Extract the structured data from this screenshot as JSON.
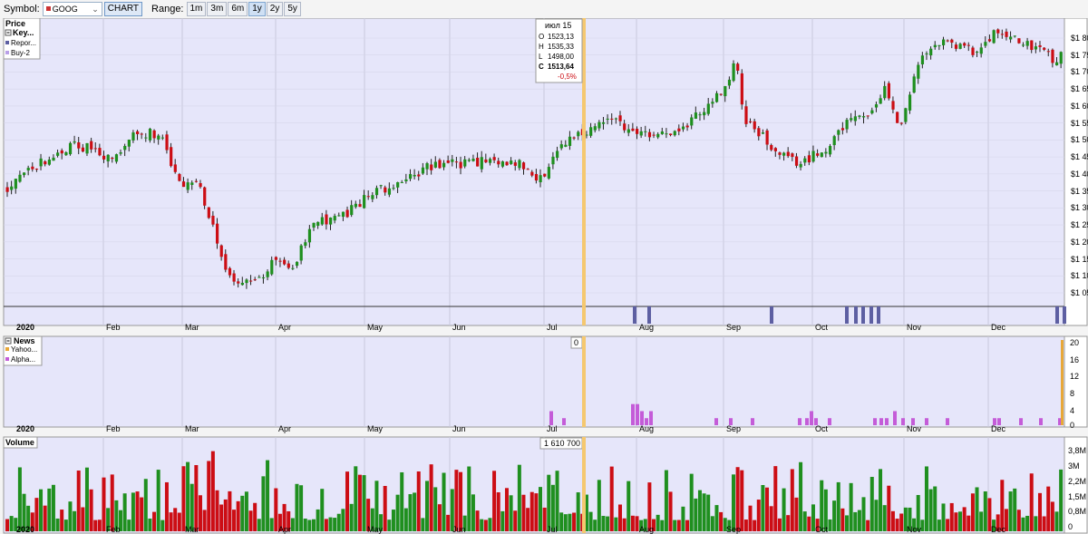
{
  "toolbar": {
    "symbol_label": "Symbol:",
    "symbol_value": "GOOG",
    "chart_button": "CHART",
    "range_label": "Range:",
    "ranges": [
      "1m",
      "3m",
      "6m",
      "1y",
      "2y",
      "5y"
    ],
    "active_range": "1y"
  },
  "colors": {
    "up": "#1f8f1f",
    "down": "#cc0d14",
    "cursor": "#f5c870",
    "panel_bg": "#e6e6fa",
    "report": "#5d5fa2",
    "news_alpha": "#c45cd8",
    "news_yahoo": "#e8a838"
  },
  "months": [
    "2020",
    "Feb",
    "Mar",
    "Apr",
    "May",
    "Jun",
    "Jul",
    "Aug",
    "Sep",
    "Oct",
    "Nov",
    "Dec"
  ],
  "price_panel": {
    "title": "Price",
    "key_title": "Key...",
    "legend": [
      {
        "name": "Repor...",
        "icon": "square-icon"
      },
      {
        "name": "Buy-2",
        "icon": "square-icon"
      }
    ],
    "y_ticks": [
      "$1 80",
      "$1 75",
      "$1 70",
      "$1 65",
      "$1 60",
      "$1 55",
      "$1 50",
      "$1 45",
      "$1 40",
      "$1 35",
      "$1 30",
      "$1 25",
      "$1 20",
      "$1 15",
      "$1 10",
      "$1 05"
    ],
    "tooltip": {
      "date": "июл 15",
      "o_label": "O",
      "o": "1523,13",
      "h_label": "H",
      "h": "1535,33",
      "l_label": "L",
      "l": "1498,00",
      "c_label": "C",
      "c": "1513,64",
      "change": "-0,5%"
    }
  },
  "news_panel": {
    "title": "News",
    "legend": [
      {
        "name": "Yahoo...",
        "icon": "square-icon"
      },
      {
        "name": "Alpha...",
        "icon": "square-icon"
      }
    ],
    "y_ticks": [
      "20",
      "16",
      "12",
      "8",
      "4",
      "0"
    ],
    "cursor_value": "0"
  },
  "volume_panel": {
    "title": "Volume",
    "y_ticks": [
      "3,8M",
      "3M",
      "2,2M",
      "1,5M",
      "0,8M",
      "0"
    ],
    "cursor_value": "1 610 700"
  },
  "chart_data": {
    "type": "candlestick",
    "symbol": "GOOG",
    "range": "1y",
    "x": [
      "2020",
      "Feb",
      "Mar",
      "Apr",
      "May",
      "Jun",
      "Jul",
      "Aug",
      "Sep",
      "Oct",
      "Nov",
      "Dec"
    ],
    "monthly_approx": [
      {
        "month": "2020",
        "open": 1360,
        "high": 1420,
        "low": 1340,
        "close": 1410
      },
      {
        "month": "Feb",
        "open": 1440,
        "high": 1530,
        "low": 1430,
        "close": 1510
      },
      {
        "month": "Mar",
        "open": 1390,
        "high": 1400,
        "low": 1060,
        "close": 1130
      },
      {
        "month": "Apr",
        "open": 1110,
        "high": 1300,
        "low": 1100,
        "close": 1290
      },
      {
        "month": "May",
        "open": 1320,
        "high": 1440,
        "low": 1300,
        "close": 1420
      },
      {
        "month": "Jun",
        "open": 1430,
        "high": 1480,
        "low": 1390,
        "close": 1450
      },
      {
        "month": "Jul",
        "open": 1460,
        "high": 1590,
        "low": 1460,
        "close": 1500
      },
      {
        "month": "Aug",
        "open": 1490,
        "high": 1660,
        "low": 1470,
        "close": 1640
      },
      {
        "month": "Sep",
        "open": 1660,
        "high": 1740,
        "low": 1410,
        "close": 1470
      },
      {
        "month": "Oct",
        "open": 1460,
        "high": 1690,
        "low": 1440,
        "close": 1620
      },
      {
        "month": "Nov",
        "open": 1650,
        "high": 1810,
        "low": 1630,
        "close": 1760
      },
      {
        "month": "Dec",
        "open": 1790,
        "high": 1830,
        "low": 1720,
        "close": 1740
      }
    ],
    "cursor": {
      "date": "июл 15",
      "open": 1523.13,
      "high": 1535.33,
      "low": 1498.0,
      "close": 1513.64,
      "change_pct": -0.5,
      "volume": 1610700,
      "news": 0
    },
    "price_range": [
      1030,
      1840
    ],
    "volume_range": [
      0,
      4100000
    ],
    "news_range": [
      0,
      21
    ]
  }
}
